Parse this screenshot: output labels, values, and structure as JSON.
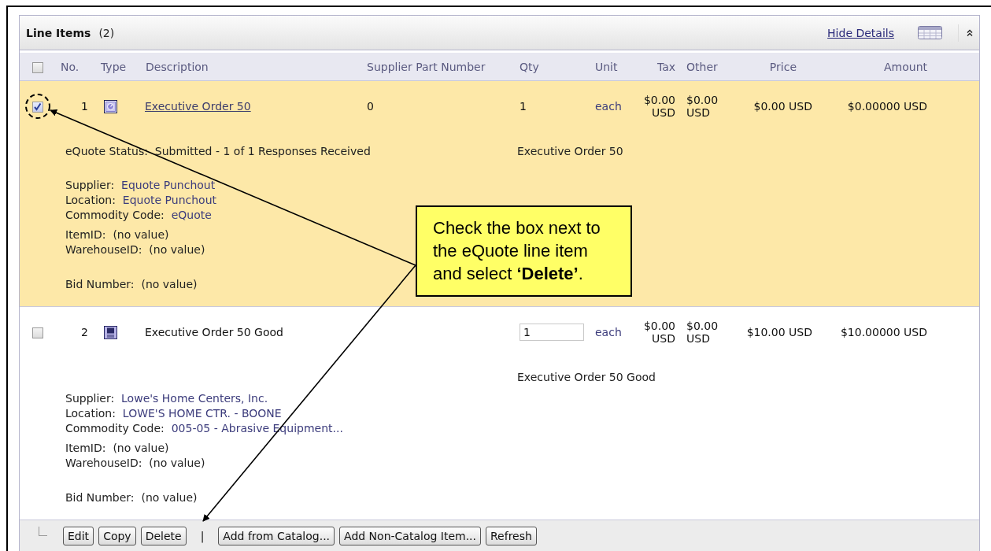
{
  "panel": {
    "title": "Line Items",
    "count": "(2)",
    "hide_details_link": "Hide Details",
    "select_all_checked": false
  },
  "columns": [
    "No.",
    "Type",
    "Description",
    "Supplier Part Number",
    "Qty",
    "Unit",
    "Tax",
    "Other",
    "Price",
    "Amount"
  ],
  "rows": [
    {
      "checked": true,
      "no": "1",
      "kind": "quote",
      "description": "Executive Order 50",
      "description_linked": true,
      "supplier_part_number": "0",
      "qty": {
        "value": "1",
        "editable": false
      },
      "unit": "each",
      "tax": "$0.00 USD",
      "other": "$0.00 USD",
      "price": "$0.00 USD",
      "amount": "$0.00000 USD",
      "details": {
        "status": "eQuote Status:  Submitted - 1 of 1 Responses Received",
        "summary": "Executive Order 50",
        "groups": [
          [
            {
              "label": "Supplier:",
              "value": "Equote Punchout",
              "linked": true
            },
            {
              "label": "Location:",
              "value": "Equote Punchout",
              "linked": true
            },
            {
              "label": "Commodity Code:",
              "value": "eQuote",
              "linked": true
            }
          ],
          [
            {
              "label": "ItemID:",
              "value": "(no value)",
              "linked": false
            },
            {
              "label": "WarehouseID:",
              "value": "(no value)",
              "linked": false
            }
          ],
          [
            {
              "label": "Bid Number:",
              "value": "(no value)",
              "linked": false
            }
          ]
        ]
      }
    },
    {
      "checked": false,
      "no": "2",
      "kind": "good",
      "description": "Executive Order 50 Good",
      "description_linked": false,
      "qty": {
        "value": "1",
        "editable": true
      },
      "unit": "each",
      "tax": "$0.00 USD",
      "other": "$0.00 USD",
      "price": "$10.00 USD",
      "amount": "$10.00000 USD",
      "details": {
        "summary": "Executive Order 50 Good",
        "groups": [
          [
            {
              "label": "Supplier:",
              "value": "Lowe's Home Centers, Inc.",
              "linked": true
            },
            {
              "label": "Location:",
              "value": "LOWE'S HOME CTR. - BOONE",
              "linked": true
            },
            {
              "label": "Commodity Code:",
              "value": "005-05 - Abrasive Equipment...",
              "linked": true
            }
          ],
          [
            {
              "label": "ItemID:",
              "value": "(no value)",
              "linked": false
            },
            {
              "label": "WarehouseID:",
              "value": "(no value)",
              "linked": false
            }
          ],
          [
            {
              "label": "Bid Number:",
              "value": "(no value)",
              "linked": false
            }
          ]
        ]
      }
    }
  ],
  "toolbar": [
    {
      "kind": "button",
      "label": "Edit"
    },
    {
      "kind": "button",
      "label": "Copy"
    },
    {
      "kind": "button",
      "label": "Delete"
    },
    {
      "kind": "separator",
      "label": "|"
    },
    {
      "kind": "button",
      "label": "Add from Catalog..."
    },
    {
      "kind": "button",
      "label": "Add Non-Catalog Item..."
    },
    {
      "kind": "button",
      "label": "Refresh"
    }
  ],
  "callout": {
    "text": "Check the box next to the eQuote line item and select **‘Delete’**."
  }
}
